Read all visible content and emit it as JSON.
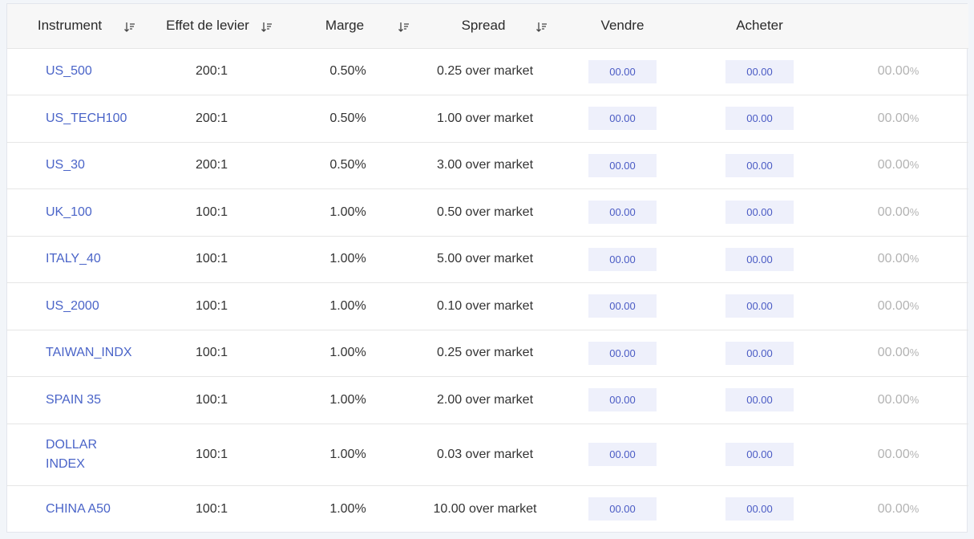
{
  "headers": {
    "instrument": "Instrument",
    "leverage": "Effet de levier",
    "margin": "Marge",
    "spread": "Spread",
    "sell": "Vendre",
    "buy": "Acheter"
  },
  "rows": [
    {
      "instrument": "US_500",
      "leverage": "200:1",
      "margin": "0.50%",
      "spread": "0.25 over market",
      "sell": "00.00",
      "buy": "00.00",
      "change": "00.00",
      "pct": "%"
    },
    {
      "instrument": "US_TECH100",
      "leverage": "200:1",
      "margin": "0.50%",
      "spread": "1.00 over market",
      "sell": "00.00",
      "buy": "00.00",
      "change": "00.00",
      "pct": "%"
    },
    {
      "instrument": "US_30",
      "leverage": "200:1",
      "margin": "0.50%",
      "spread": "3.00 over market",
      "sell": "00.00",
      "buy": "00.00",
      "change": "00.00",
      "pct": "%"
    },
    {
      "instrument": "UK_100",
      "leverage": "100:1",
      "margin": "1.00%",
      "spread": "0.50 over market",
      "sell": "00.00",
      "buy": "00.00",
      "change": "00.00",
      "pct": "%"
    },
    {
      "instrument": "ITALY_40",
      "leverage": "100:1",
      "margin": "1.00%",
      "spread": "5.00 over market",
      "sell": "00.00",
      "buy": "00.00",
      "change": "00.00",
      "pct": "%"
    },
    {
      "instrument": "US_2000",
      "leverage": "100:1",
      "margin": "1.00%",
      "spread": "0.10 over market",
      "sell": "00.00",
      "buy": "00.00",
      "change": "00.00",
      "pct": "%"
    },
    {
      "instrument": "TAIWAN_INDX",
      "leverage": "100:1",
      "margin": "1.00%",
      "spread": "0.25 over market",
      "sell": "00.00",
      "buy": "00.00",
      "change": "00.00",
      "pct": "%"
    },
    {
      "instrument": "SPAIN 35",
      "leverage": "100:1",
      "margin": "1.00%",
      "spread": "2.00 over market",
      "sell": "00.00",
      "buy": "00.00",
      "change": "00.00",
      "pct": "%"
    },
    {
      "instrument": "DOLLAR INDEX",
      "leverage": "100:1",
      "margin": "1.00%",
      "spread": "0.03 over market",
      "sell": "00.00",
      "buy": "00.00",
      "change": "00.00",
      "pct": "%"
    },
    {
      "instrument": "CHINA A50",
      "leverage": "100:1",
      "margin": "1.00%",
      "spread": "10.00 over market",
      "sell": "00.00",
      "buy": "00.00",
      "change": "00.00",
      "pct": "%"
    }
  ]
}
